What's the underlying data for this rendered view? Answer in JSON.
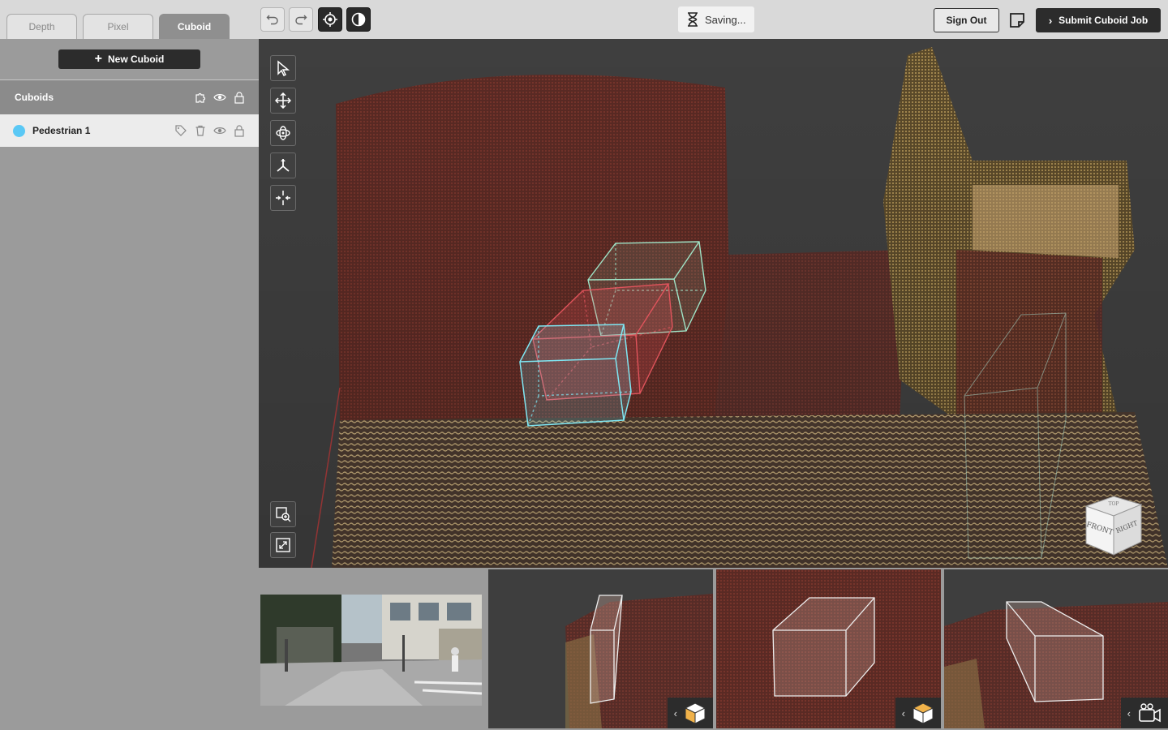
{
  "tabs": [
    {
      "label": "Depth",
      "active": false
    },
    {
      "label": "Pixel",
      "active": false
    },
    {
      "label": "Cuboid",
      "active": true
    }
  ],
  "toolbar": {
    "undo_icon": "undo-icon",
    "redo_icon": "redo-icon",
    "focus_icon": "crosshair-icon",
    "contrast_icon": "contrast-icon",
    "saving_label": "Saving...",
    "sign_out_label": "Sign Out",
    "notes_icon": "sticky-note-icon",
    "submit_label": "Submit Cuboid Job"
  },
  "sidebar": {
    "new_cuboid_label": "New Cuboid",
    "section_title": "Cuboids",
    "items": [
      {
        "label": "Pedestrian 1",
        "color": "#5ac8f5"
      }
    ]
  },
  "viewport": {
    "tools": [
      "select-icon",
      "move-icon",
      "rotate-icon",
      "axis-icon",
      "center-icon"
    ],
    "bottom_tools": [
      "zoom-region-icon",
      "fit-view-icon"
    ],
    "cube_faces": {
      "front": "FRONT",
      "right": "RIGHT",
      "top": "TOP"
    }
  },
  "colors": {
    "accent": "#2c2c2c",
    "cuboid_cyan": "#7fe6f2",
    "cuboid_red": "#e0545c",
    "cuboid_green": "#9fe3c6"
  }
}
